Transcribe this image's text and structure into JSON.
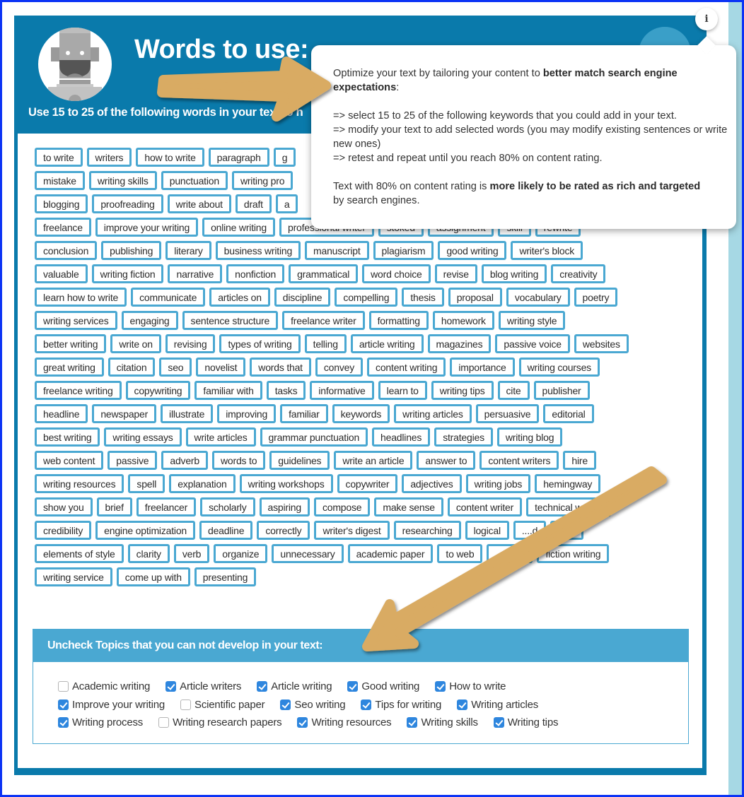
{
  "header": {
    "title": "Words to use:",
    "subtitle": "Use 15 to 25 of the following words in your text to h"
  },
  "info_button": {
    "icon": "info-icon",
    "label": "i"
  },
  "popup": {
    "p1_normal": "Optimize your text by tailoring your content to ",
    "p1_bold": "better match search engine expectations",
    "p1_end": ":",
    "steps": [
      "=> select 15 to 25 of the following keywords that you could add in your text.",
      "=> modify your text to add selected words (you may modify existing sentences or write new ones)",
      "=> retest and repeat until you reach 80% on content rating."
    ],
    "p3_normal": "Text with 80% on content rating is ",
    "p3_bold1": "more likely to be rated as rich and targeted",
    "p3_end": " by search engines."
  },
  "keyword_rows": [
    [
      "to write",
      "writers",
      "how to write",
      "paragraph",
      "g"
    ],
    [
      "mistake",
      "writing skills",
      "punctuation",
      "writing pro"
    ],
    [
      "blogging",
      "proofreading",
      "write about",
      "draft",
      "a"
    ],
    [
      "freelance",
      "improve your writing",
      "online writing",
      "professional writer",
      "stoked",
      "assignment",
      "skill",
      "rewrite"
    ],
    [
      "conclusion",
      "publishing",
      "literary",
      "business writing",
      "manuscript",
      "plagiarism",
      "good writing",
      "writer's block"
    ],
    [
      "valuable",
      "writing fiction",
      "narrative",
      "nonfiction",
      "grammatical",
      "word choice",
      "revise",
      "blog writing",
      "creativity"
    ],
    [
      "learn how to write",
      "communicate",
      "articles on",
      "discipline",
      "compelling",
      "thesis",
      "proposal",
      "vocabulary",
      "poetry"
    ],
    [
      "writing services",
      "engaging",
      "sentence structure",
      "freelance writer",
      "formatting",
      "homework",
      "writing style"
    ],
    [
      "better writing",
      "write on",
      "revising",
      "types of writing",
      "telling",
      "article writing",
      "magazines",
      "passive voice",
      "websites"
    ],
    [
      "great writing",
      "citation",
      "seo",
      "novelist",
      "words that",
      "convey",
      "content writing",
      "importance",
      "writing courses"
    ],
    [
      "freelance writing",
      "copywriting",
      "familiar with",
      "tasks",
      "informative",
      "learn to",
      "writing tips",
      "cite",
      "publisher"
    ],
    [
      "headline",
      "newspaper",
      "illustrate",
      "improving",
      "familiar",
      "keywords",
      "writing articles",
      "persuasive",
      "editorial"
    ],
    [
      "best writing",
      "writing essays",
      "write articles",
      "grammar punctuation",
      "headlines",
      "strategies",
      "writing blog"
    ],
    [
      "web content",
      "passive",
      "adverb",
      "words to",
      "guidelines",
      "write an article",
      "answer to",
      "content writers",
      "hire"
    ],
    [
      "writing resources",
      "spell",
      "explanation",
      "writing workshops",
      "copywriter",
      "adjectives",
      "writing jobs",
      "hemingway"
    ],
    [
      "show you",
      "brief",
      "freelancer",
      "scholarly",
      "aspiring",
      "compose",
      "make sense",
      "content writer",
      "technical writing"
    ],
    [
      "credibility",
      "engine optimization",
      "deadline",
      "correctly",
      "writer's digest",
      "researching",
      "logical",
      "....d",
      "lists"
    ],
    [
      "elements of style",
      "clarity",
      "verb",
      "organize",
      "unnecessary",
      "academic paper",
      "to web",
      "...ritten",
      "fiction writing"
    ],
    [
      "writing service",
      "come up with",
      "presenting"
    ]
  ],
  "topics": {
    "heading": "Uncheck Topics that you can not develop in your text:",
    "rows": [
      [
        {
          "label": "Academic writing",
          "checked": false
        },
        {
          "label": "Article writers",
          "checked": true
        },
        {
          "label": "Article writing",
          "checked": true
        },
        {
          "label": "Good writing",
          "checked": true
        },
        {
          "label": "How to write",
          "checked": true
        }
      ],
      [
        {
          "label": "Improve your writing",
          "checked": true
        },
        {
          "label": "Scientific paper",
          "checked": false
        },
        {
          "label": "Seo writing",
          "checked": true
        },
        {
          "label": "Tips for writing",
          "checked": true
        },
        {
          "label": "Writing articles",
          "checked": true
        }
      ],
      [
        {
          "label": "Writing process",
          "checked": true
        },
        {
          "label": "Writing research papers",
          "checked": false
        },
        {
          "label": "Writing resources",
          "checked": true
        },
        {
          "label": "Writing skills",
          "checked": true
        },
        {
          "label": "Writing tips",
          "checked": true
        }
      ]
    ]
  },
  "colors": {
    "panel": "#0a7aab",
    "keyword_border": "#4aa8d2",
    "checkbox_on": "#2e86de",
    "arrow": "#d9ab63",
    "frame": "#0b33f5"
  }
}
